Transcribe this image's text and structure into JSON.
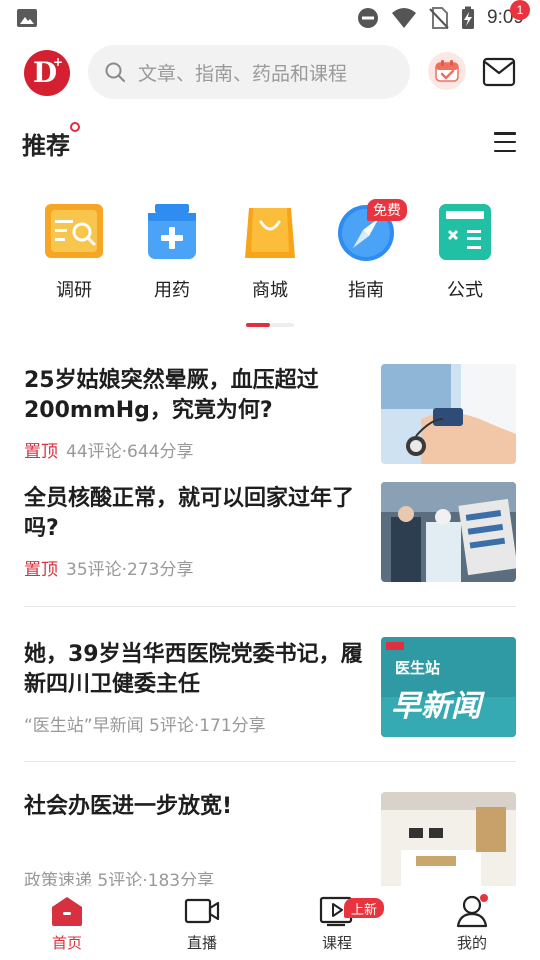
{
  "status_bar": {
    "time": "9:09",
    "icons": [
      "image-icon",
      "dnd-icon",
      "wifi-icon",
      "no-sim-icon",
      "battery-charging-icon"
    ]
  },
  "header": {
    "logo_letter": "D",
    "logo_plus": "+",
    "search_placeholder": "文章、指南、药品和课程",
    "mail_badge": "1",
    "colors": {
      "brand": "#d42031",
      "badge": "#e8343f"
    }
  },
  "section": {
    "title": "推荐"
  },
  "categories": [
    {
      "label": "调研",
      "icon": "survey-icon",
      "color": "#f6a623"
    },
    {
      "label": "用药",
      "icon": "medicine-icon",
      "color": "#2f8cf0"
    },
    {
      "label": "商城",
      "icon": "shop-bag-icon",
      "color": "#f7a418"
    },
    {
      "label": "指南",
      "icon": "compass-icon",
      "color": "#2f8cf0",
      "badge": "免费"
    },
    {
      "label": "公式",
      "icon": "calculator-icon",
      "color": "#21c0a4"
    }
  ],
  "articles": [
    {
      "title": "25岁姑娘突然晕厥，血压超过200mmHg，究竟为何?",
      "pin": "置顶",
      "meta": "44评论·644分享"
    },
    {
      "title": "全员核酸正常，就可以回家过年了吗?",
      "pin": "置顶",
      "meta": "35评论·273分享"
    },
    {
      "title": "她，39岁当华西医院党委书记，履新四川卫健委主任",
      "meta": "“医生站”早新闻 5评论·171分享",
      "thumb_text_1": "医生站",
      "thumb_text_2": "早新闻"
    },
    {
      "title": "社会办医进一步放宽!",
      "meta": "政策速递 5评论·183分享"
    }
  ],
  "bottom_nav": [
    {
      "label": "首页",
      "icon": "home-icon",
      "active": true
    },
    {
      "label": "直播",
      "icon": "video-icon"
    },
    {
      "label": "课程",
      "icon": "course-play-icon",
      "badge": "上新"
    },
    {
      "label": "我的",
      "icon": "profile-icon"
    }
  ]
}
